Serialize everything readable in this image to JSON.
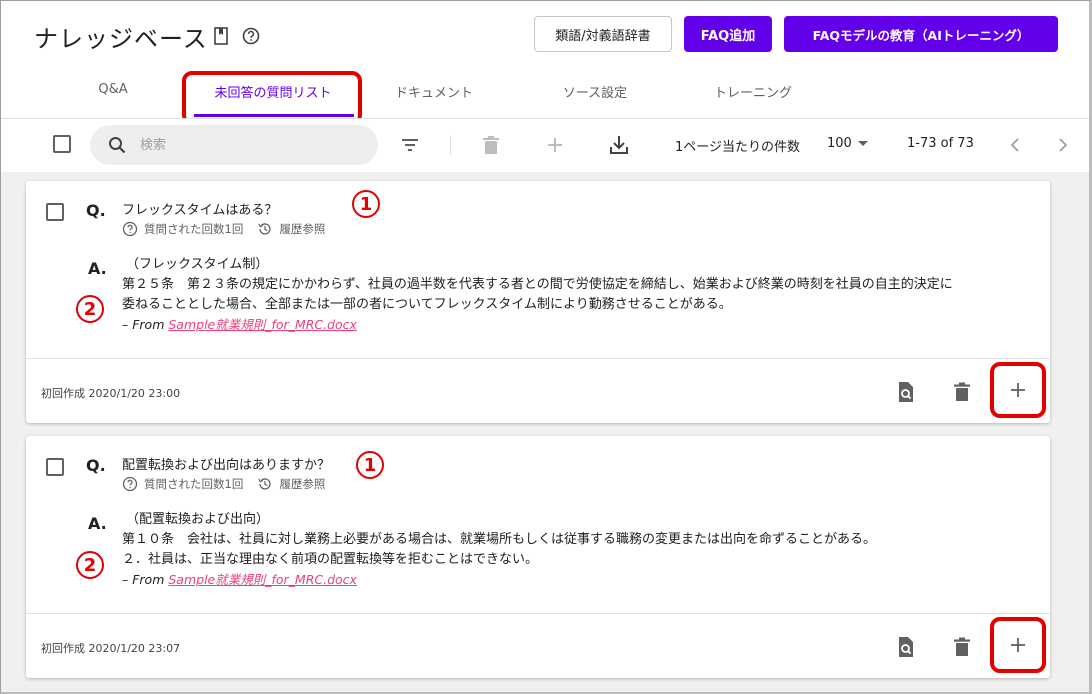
{
  "header": {
    "title": "ナレッジベース",
    "buttons": {
      "dictionary": "類語/対義語辞書",
      "faq_add": "FAQ追加",
      "faq_training": "FAQモデルの教育（AIトレーニング）"
    }
  },
  "tabs": [
    {
      "label": "Q&A"
    },
    {
      "label": "未回答の質問リスト"
    },
    {
      "label": "ドキュメント"
    },
    {
      "label": "ソース設定"
    },
    {
      "label": "トレーニング"
    }
  ],
  "toolbar": {
    "search_placeholder": "検索",
    "per_page_label": "1ページ当たりの件数",
    "per_page_value": "100",
    "range": "1-73 of 73"
  },
  "cards": [
    {
      "q_mark": "Q.",
      "question": "フレックスタイムはある？",
      "asked_count": "質問された回数1回",
      "history": "履歴参照",
      "a_mark": "A.",
      "answer_title": "（フレックスタイム制）",
      "answer_lines": [
        "第２５条　第２３条の規定にかかわらず、社員の過半数を代表する者との間で労使協定を締結し、始業および終業の時刻を社員の自主的決定に",
        "委ねることとした場合、全部または一部の者についてフレックスタイム制により勤務させることがある。"
      ],
      "from_prefix": "– From ",
      "from_link": "Sample就業規則_for_MRC.docx",
      "created": "初回作成 2020/1/20 23:00",
      "anno_q": "1",
      "anno_a": "2"
    },
    {
      "q_mark": "Q.",
      "question": "配置転換および出向はありますか？",
      "asked_count": "質問された回数1回",
      "history": "履歴参照",
      "a_mark": "A.",
      "answer_title": "（配置転換および出向）",
      "answer_lines": [
        "第１０条　会社は、社員に対し業務上必要がある場合は、就業場所もしくは従事する職務の変更または出向を命ずることがある。",
        "２．社員は、正当な理由なく前項の配置転換等を拒むことはできない。"
      ],
      "from_prefix": "– From ",
      "from_link": "Sample就業規則_for_MRC.docx",
      "created": "初回作成 2020/1/20 23:07",
      "anno_q": "1",
      "anno_a": "2"
    }
  ],
  "icons": {
    "bookmark": "bookmark-icon",
    "help": "help-circle-icon",
    "search": "search-icon",
    "filter": "filter-icon",
    "delete": "trash-icon",
    "add": "plus-icon",
    "download": "download-icon",
    "prev": "chevron-left-icon",
    "next": "chevron-right-icon",
    "question_circle": "question-circle-icon",
    "history": "history-icon",
    "preview": "document-search-icon"
  },
  "colors": {
    "primary": "#6200ea",
    "highlight": "#e50000",
    "link": "#ec407a"
  }
}
